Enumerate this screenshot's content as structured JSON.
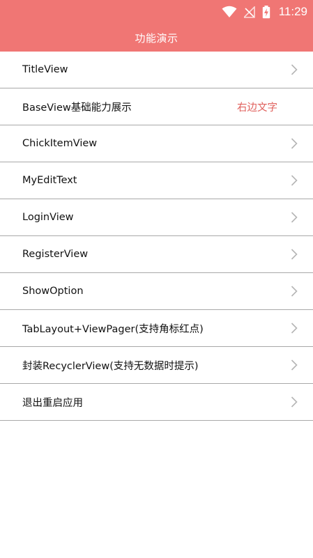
{
  "status_bar": {
    "time": "11:29",
    "icons": [
      "wifi-icon",
      "no-signal-icon",
      "battery-charging-icon"
    ]
  },
  "titlebar": {
    "title": "功能演示"
  },
  "menu": {
    "items": [
      {
        "label": "TitleView",
        "right_text": null,
        "icon": "chevron-right-icon"
      },
      {
        "label": "BaseView基础能力展示",
        "right_text": "右边文字",
        "icon": null
      },
      {
        "label": "ChickItemView",
        "right_text": null,
        "icon": "chevron-right-icon"
      },
      {
        "label": "MyEditText",
        "right_text": null,
        "icon": "chevron-right-icon"
      },
      {
        "label": "LoginView",
        "right_text": null,
        "icon": "chevron-right-icon"
      },
      {
        "label": "RegisterView",
        "right_text": null,
        "icon": "chevron-right-icon"
      },
      {
        "label": "ShowOption",
        "right_text": null,
        "icon": "chevron-right-icon"
      },
      {
        "label": "TabLayout+ViewPager(支持角标红点)",
        "right_text": null,
        "icon": "chevron-right-icon"
      },
      {
        "label": "封装RecyclerView(支持无数据时提示)",
        "right_text": null,
        "icon": "chevron-right-icon"
      },
      {
        "label": "退出重启应用",
        "right_text": null,
        "icon": "chevron-right-icon"
      }
    ]
  },
  "colors": {
    "primary": "#f07674",
    "accent_text": "#e0605c",
    "divider": "#a8a8a8",
    "chevron": "#b5b5b5"
  }
}
